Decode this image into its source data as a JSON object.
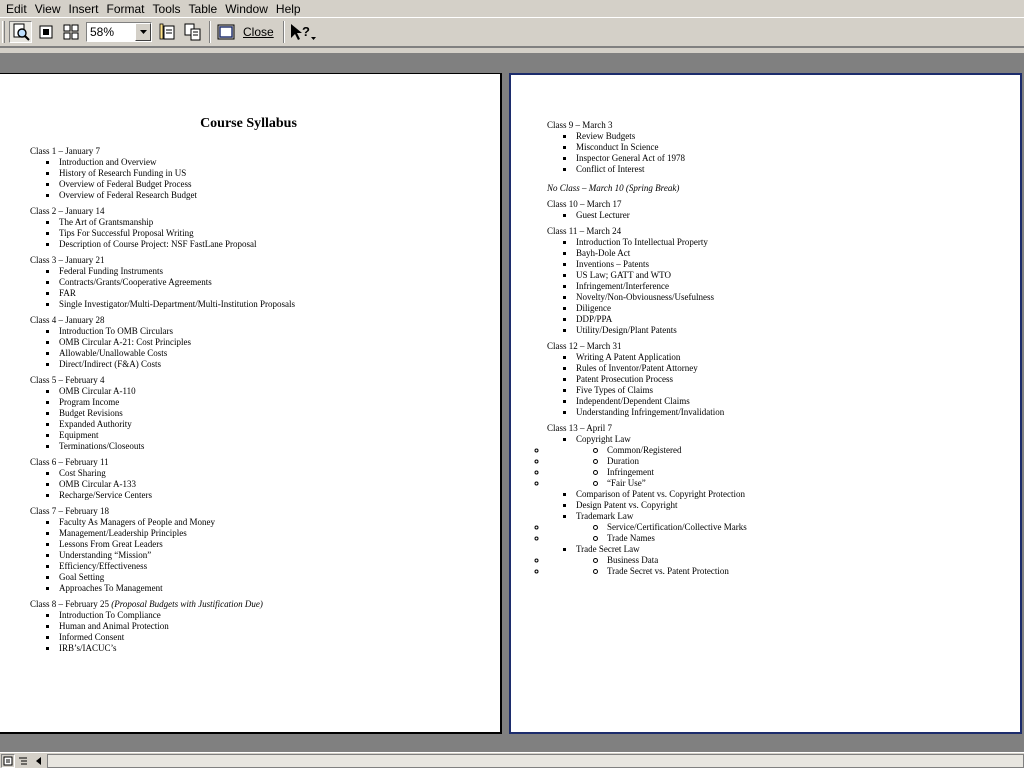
{
  "menu": [
    "Edit",
    "View",
    "Insert",
    "Format",
    "Tools",
    "Table",
    "Window",
    "Help"
  ],
  "toolbar": {
    "zoom": "58%",
    "close_label": "Close"
  },
  "icons": {
    "magnifier": "magnifier-icon",
    "one_page": "one-page-icon",
    "multiple_pages": "multiple-pages-icon",
    "view_ruler": "view-ruler-icon",
    "shrink_to_fit": "shrink-to-fit-icon",
    "full_screen": "full-screen-icon",
    "context_help": "context-help-icon"
  },
  "colors": {
    "chrome": "#d4d0c8",
    "workspace": "#808080",
    "page_border_active": "#1c2c6c"
  },
  "doc": {
    "title": "Course Syllabus",
    "page1": [
      {
        "head": "Class 1 – January 7",
        "items": [
          "Introduction and Overview",
          "History of Research Funding in US",
          "Overview of Federal Budget Process",
          "Overview of Federal Research Budget"
        ]
      },
      {
        "head": "Class 2 – January 14",
        "items": [
          "The Art of Grantsmanship",
          "Tips For Successful Proposal Writing",
          "Description of Course Project:  NSF FastLane Proposal"
        ]
      },
      {
        "head": "Class 3 – January 21",
        "items": [
          "Federal Funding Instruments",
          "Contracts/Grants/Cooperative Agreements",
          "FAR",
          "Single Investigator/Multi-Department/Multi-Institution Proposals"
        ]
      },
      {
        "head": "Class 4 – January 28",
        "items": [
          "Introduction To OMB Circulars",
          "OMB Circular A-21:  Cost Principles",
          "Allowable/Unallowable Costs",
          "Direct/Indirect (F&A) Costs"
        ]
      },
      {
        "head": "Class 5 – February 4",
        "items": [
          "OMB Circular A-110",
          "Program Income",
          "Budget Revisions",
          "Expanded Authority",
          "Equipment",
          "Terminations/Closeouts"
        ]
      },
      {
        "head": "Class 6 – February 11",
        "items": [
          "Cost Sharing",
          "OMB Circular A-133",
          "Recharge/Service Centers"
        ]
      },
      {
        "head": "Class 7 – February 18",
        "items": [
          "Faculty As Managers of People and Money",
          "Management/Leadership Principles",
          "Lessons From Great Leaders",
          "Understanding “Mission”",
          "Efficiency/Effectiveness",
          "Goal Setting",
          "Approaches To Management"
        ]
      },
      {
        "head": "Class 8 – February 25 ",
        "note": "(Proposal Budgets with Justification Due)",
        "items": [
          "Introduction To Compliance",
          "Human and Animal Protection",
          "Informed Consent",
          "IRB’s/IACUC’s"
        ]
      }
    ],
    "page2": [
      {
        "head": "Class 9 – March 3",
        "items": [
          "Review Budgets",
          "Misconduct In Science",
          "Inspector General Act of 1978",
          "Conflict of Interest"
        ]
      },
      {
        "no_class": "No Class – March 10 (Spring Break)"
      },
      {
        "head": "Class 10 – March 17",
        "items": [
          "Guest Lecturer"
        ]
      },
      {
        "head": "Class 11 – March 24",
        "items": [
          "Introduction To Intellectual Property",
          "Bayh-Dole Act",
          "Inventions – Patents",
          "US Law; GATT and WTO",
          "Infringement/Interference",
          "Novelty/Non-Obviousness/Usefulness",
          "Diligence",
          "DDP/PPA",
          "Utility/Design/Plant Patents"
        ]
      },
      {
        "head": "Class 12 – March 31",
        "items": [
          "Writing A Patent Application",
          "Rules of Inventor/Patent Attorney",
          "Patent Prosecution Process",
          "Five Types of Claims",
          "Independent/Dependent Claims",
          "Understanding Infringement/Invalidation"
        ]
      },
      {
        "head": "Class 13 – April 7",
        "items": [
          {
            "text": "Copyright Law",
            "sub": [
              "Common/Registered",
              "Duration",
              "Infringement",
              "“Fair Use”"
            ]
          },
          "Comparison of Patent vs. Copyright Protection",
          "Design Patent vs. Copyright",
          {
            "text": "Trademark Law",
            "sub": [
              "Service/Certification/Collective Marks",
              "Trade Names"
            ]
          },
          {
            "text": "Trade Secret Law",
            "sub": [
              "Business Data",
              "Trade Secret vs. Patent Protection"
            ]
          }
        ]
      }
    ]
  }
}
